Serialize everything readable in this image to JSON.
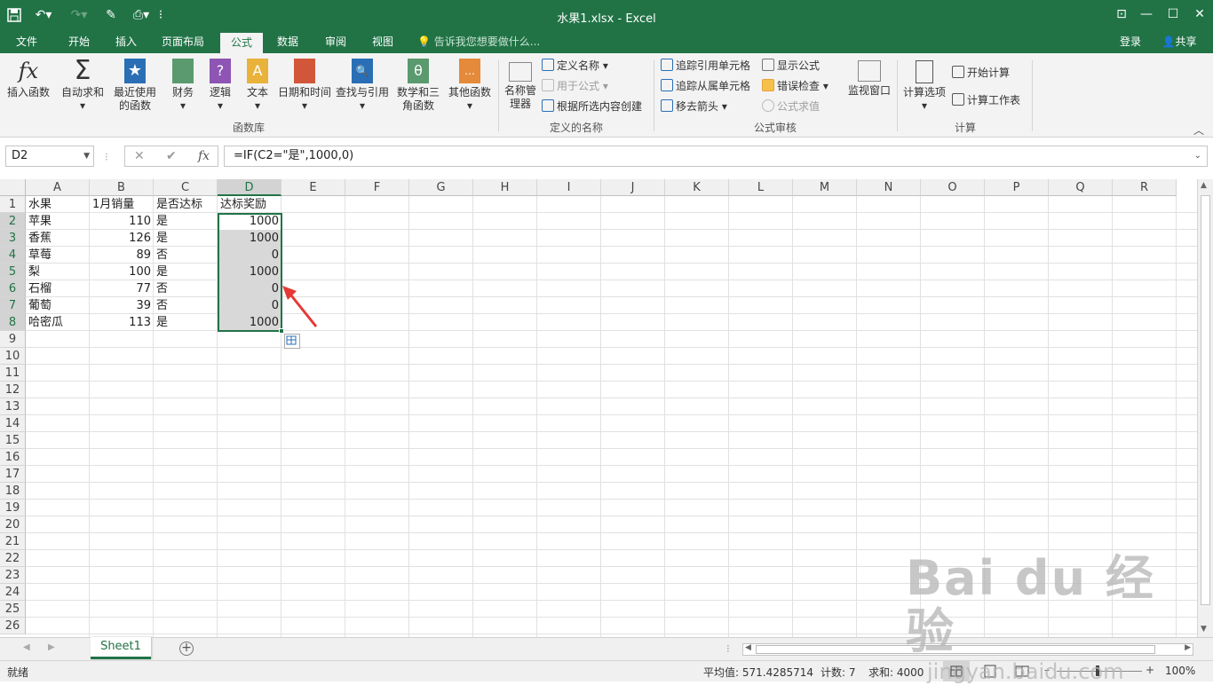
{
  "window": {
    "title": "水果1.xlsx - Excel"
  },
  "menu": {
    "tabs": [
      "文件",
      "开始",
      "插入",
      "页面布局",
      "公式",
      "数据",
      "审阅",
      "视图"
    ],
    "active_tab": "公式",
    "tell_me": "告诉我您想要做什么...",
    "login": "登录",
    "share": "共享"
  },
  "ribbon": {
    "function_library": {
      "group_label": "函数库",
      "insert_function": "插入函数",
      "autosum": "自动求和",
      "recent": "最近使用的函数",
      "financial": "财务",
      "logical": "逻辑",
      "text": "文本",
      "datetime": "日期和时间",
      "lookup": "查找与引用",
      "math": "数学和三角函数",
      "other": "其他函数"
    },
    "defined_names": {
      "group_label": "定义的名称",
      "name_manager": "名称管理器",
      "define_name": "定义名称",
      "use_in_formula": "用于公式",
      "create_from_selection": "根据所选内容创建"
    },
    "formula_auditing": {
      "group_label": "公式审核",
      "trace_precedents": "追踪引用单元格",
      "trace_dependents": "追踪从属单元格",
      "remove_arrows": "移去箭头",
      "show_formulas": "显示公式",
      "error_checking": "错误检查",
      "evaluate_formula": "公式求值",
      "watch_window": "监视窗口"
    },
    "calculation": {
      "group_label": "计算",
      "calc_options": "计算选项",
      "calc_now": "开始计算",
      "calc_sheet": "计算工作表"
    }
  },
  "formula_bar": {
    "name_box": "D2",
    "formula": "=IF(C2=\"是\",1000,0)",
    "fx": "fx"
  },
  "grid": {
    "columns": [
      "A",
      "B",
      "C",
      "D",
      "E",
      "F",
      "G",
      "H",
      "I",
      "J",
      "K",
      "L",
      "M",
      "N",
      "O",
      "P",
      "Q",
      "R"
    ],
    "rows": [
      "1",
      "2",
      "3",
      "4",
      "5",
      "6",
      "7",
      "8",
      "9",
      "10",
      "11",
      "12",
      "13",
      "14",
      "15",
      "16",
      "17",
      "18",
      "19",
      "20",
      "21",
      "22",
      "23",
      "24",
      "25",
      "26"
    ],
    "headers": [
      "水果",
      "1月销量",
      "是否达标",
      "达标奖励"
    ],
    "data": [
      [
        "苹果",
        "110",
        "是",
        "1000"
      ],
      [
        "香蕉",
        "126",
        "是",
        "1000"
      ],
      [
        "草莓",
        "89",
        "否",
        "0"
      ],
      [
        "梨",
        "100",
        "是",
        "1000"
      ],
      [
        "石榴",
        "77",
        "否",
        "0"
      ],
      [
        "葡萄",
        "39",
        "否",
        "0"
      ],
      [
        "哈密瓜",
        "113",
        "是",
        "1000"
      ]
    ]
  },
  "sheets": {
    "active": "Sheet1"
  },
  "status": {
    "ready": "就绪",
    "average": "平均值: 571.4285714",
    "count": "计数: 7",
    "sum": "求和: 4000",
    "zoom": "100%"
  },
  "watermark": {
    "brand": "Bai du 经验",
    "url": "jingyan.baidu.com"
  }
}
